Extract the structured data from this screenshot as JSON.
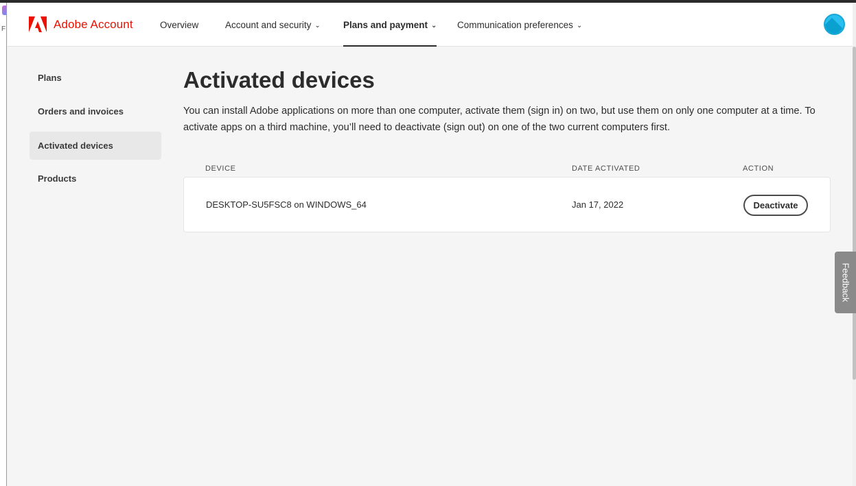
{
  "header": {
    "brand": "Adobe Account",
    "nav": {
      "overview": "Overview",
      "account_security": "Account and security",
      "plans_payment": "Plans and payment",
      "communication": "Communication preferences"
    }
  },
  "sidebar": {
    "items": [
      "Plans",
      "Orders and invoices",
      "Activated devices",
      "Products"
    ],
    "selected": "Activated devices"
  },
  "main": {
    "title": "Activated devices",
    "description": "You can install Adobe applications on more than one computer, activate them (sign in) on two, but use them on only one computer at a time. To activate apps on a third machine, you’ll need to deactivate (sign out) on one of the two current computers first.",
    "columns": {
      "device": "DEVICE",
      "date": "DATE ACTIVATED",
      "action": "ACTION"
    },
    "devices": [
      {
        "device": "DESKTOP-SU5FSC8 on WINDOWS_64",
        "date": "Jan 17, 2022",
        "action": "Deactivate"
      }
    ]
  },
  "feedback": "Feedback",
  "icons": {
    "logo": "adobe-logo-icon",
    "chevron": "chevron-down-icon",
    "avatar": "user-avatar"
  },
  "colors": {
    "brand": "#eb1000",
    "avatar": "#29c0f0"
  }
}
